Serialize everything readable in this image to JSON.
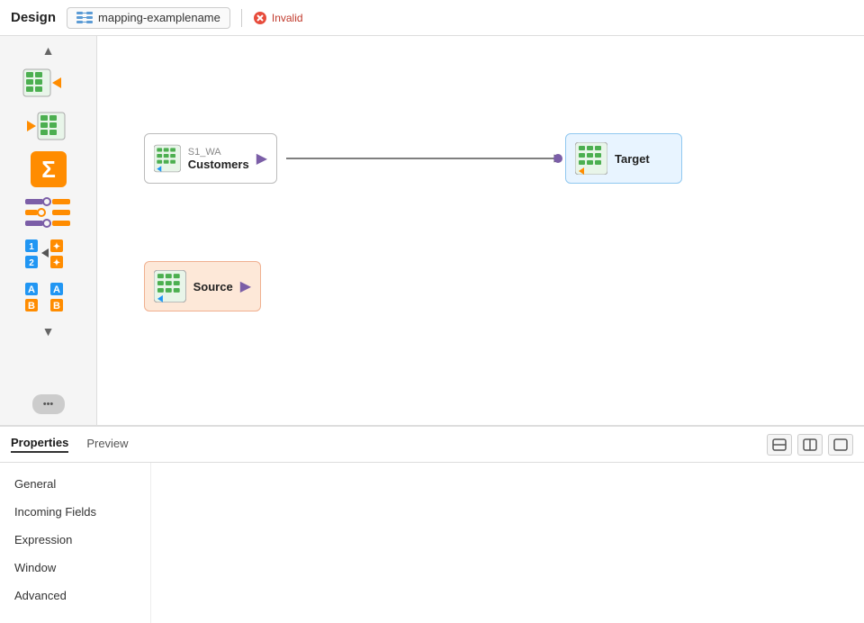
{
  "topbar": {
    "title": "Design",
    "mapping_name": "mapping-examplename",
    "status": "Invalid"
  },
  "sidebar": {
    "scroll_up": "▲",
    "scroll_down": "▼",
    "more_btn_label": "•••",
    "icons": [
      {
        "name": "source-icon",
        "label": "Source"
      },
      {
        "name": "target-icon",
        "label": "Target"
      },
      {
        "name": "aggregate-icon",
        "label": "Aggregate"
      },
      {
        "name": "filter-icon",
        "label": "Filter"
      },
      {
        "name": "convert-icon",
        "label": "Convert"
      },
      {
        "name": "rename-icon",
        "label": "Rename"
      }
    ]
  },
  "canvas": {
    "nodes": [
      {
        "id": "customers",
        "title": "S1_WA",
        "subtitle": "Customers",
        "type": "source"
      },
      {
        "id": "target",
        "title": "Target",
        "subtitle": "",
        "type": "target"
      },
      {
        "id": "source",
        "title": "Source",
        "subtitle": "",
        "type": "source-plain"
      }
    ]
  },
  "bottom_panel": {
    "tabs": [
      {
        "id": "properties",
        "label": "Properties"
      },
      {
        "id": "preview",
        "label": "Preview"
      }
    ],
    "active_tab": "properties",
    "nav_items": [
      {
        "id": "general",
        "label": "General"
      },
      {
        "id": "incoming-fields",
        "label": "Incoming Fields"
      },
      {
        "id": "expression",
        "label": "Expression"
      },
      {
        "id": "window",
        "label": "Window"
      },
      {
        "id": "advanced",
        "label": "Advanced"
      }
    ],
    "view_btns": [
      "□",
      "⊟",
      "▥"
    ]
  }
}
